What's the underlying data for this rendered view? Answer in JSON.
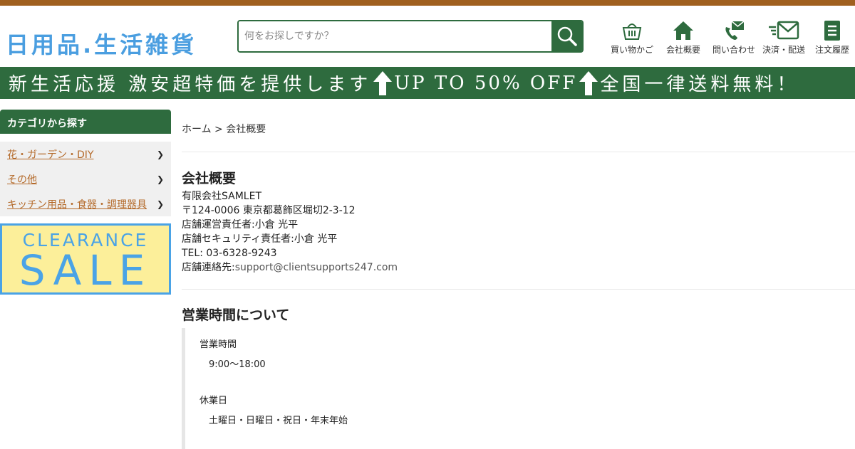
{
  "header": {
    "logo_text": "日用品.生活雑貨",
    "search_placeholder": "何をお探しですか？",
    "nav": [
      {
        "label": "買い物かご",
        "icon": "basket-icon"
      },
      {
        "label": "会社概要",
        "icon": "home-icon"
      },
      {
        "label": "問い合わせ",
        "icon": "phone-mail-icon"
      },
      {
        "label": "決済・配送",
        "icon": "fast-mail-icon"
      },
      {
        "label": "注文履歴",
        "icon": "document-icon"
      }
    ]
  },
  "banner": {
    "part1": "新生活応援 激安超特価を提供します",
    "part2": "UP TO 50% OFF",
    "part3": "全国一律送料無料！"
  },
  "sidebar": {
    "heading": "カテゴリから探す",
    "items": [
      {
        "label": "花・ガーデン・DIY"
      },
      {
        "label": "その他"
      },
      {
        "label": "キッチン用品・食器・調理器具"
      }
    ],
    "chevron": "❯",
    "sale_line1": "CLEARANCE",
    "sale_line2": "SALE"
  },
  "breadcrumb": {
    "home": "ホーム",
    "sep_current": " > 会社概要"
  },
  "company": {
    "title": "会社概要",
    "name": "有限会社SAMLET",
    "address": "〒124-0006 東京都葛飾区堀切2-3-12",
    "manager": "店舗運営責任者:小倉 光平",
    "security": "店舗セキュリティ責任者:小倉 光平",
    "tel": "TEL: 03-6328-9243",
    "contact_label": "店舗連絡先:",
    "contact_email": "support@clientsupports247.com"
  },
  "hours": {
    "title": "営業時間について",
    "open_label": "営業時間",
    "open_value": "9:00～18:00",
    "closed_label": "休業日",
    "closed_value": "土曜日・日曜日・祝日・年末年始"
  },
  "colors": {
    "brand_green": "#2e6b3e",
    "top_bar": "#a0601f",
    "logo_blue": "#4a9ee0",
    "link_orange": "#b46a2a"
  }
}
